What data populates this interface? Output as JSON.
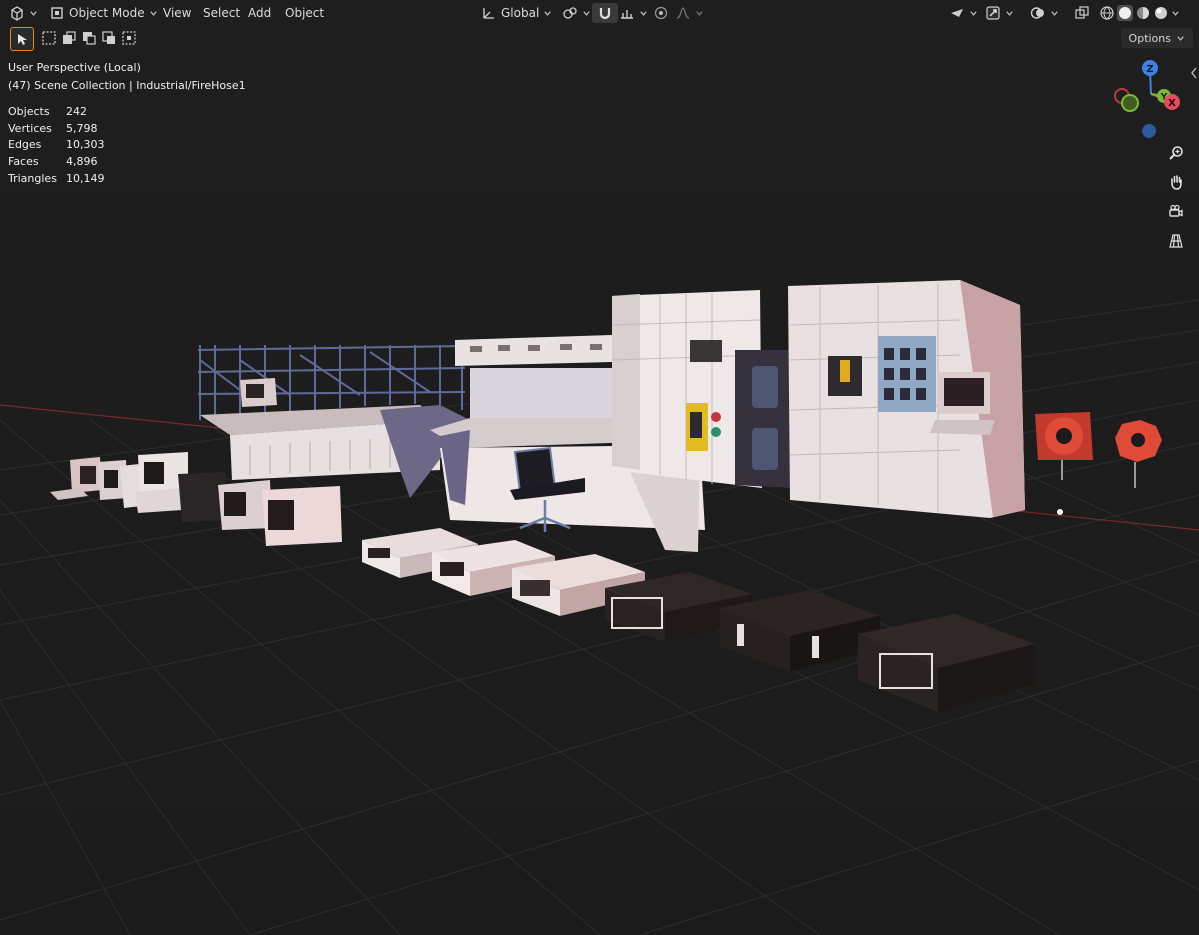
{
  "header": {
    "editor_type_icon": "view3d-icon",
    "mode_label": "Object Mode",
    "menu": [
      "View",
      "Select",
      "Add",
      "Object"
    ],
    "transform_orientation": "Global",
    "icons": {
      "pivot": "pivot-icon",
      "snap": "magnet-icon",
      "snap_target": "snap-increment-icon",
      "proportional": "proportional-edit-icon",
      "falloff": "falloff-curve-icon",
      "visibility": "visibility-icon",
      "gizmo": "gizmo-icon",
      "overlay": "overlay-icon",
      "xray": "xray-icon",
      "shading": [
        "wireframe-icon",
        "solid-icon",
        "material-preview-icon",
        "rendered-icon"
      ]
    }
  },
  "toolbar": {
    "options_label": "Options"
  },
  "viewport_info": {
    "perspective": "User Perspective (Local)",
    "collection": "(47) Scene Collection | Industrial/FireHose1"
  },
  "stats": [
    {
      "label": "Objects",
      "value": "242"
    },
    {
      "label": "Vertices",
      "value": "5,798"
    },
    {
      "label": "Edges",
      "value": "10,303"
    },
    {
      "label": "Faces",
      "value": "4,896"
    },
    {
      "label": "Triangles",
      "value": "10,149"
    }
  ],
  "gizmo": {
    "axes": [
      "Z",
      "Y",
      "X"
    ],
    "colors": {
      "x": "#e14b5a",
      "y": "#7cb83a",
      "z": "#3d82e0"
    }
  },
  "nav_buttons": [
    "zoom-icon",
    "pan-hand-icon",
    "camera-icon",
    "perspective-grid-icon"
  ],
  "colors": {
    "background": "#1d1d1d",
    "accent": "#e08a1e",
    "grid": "#2c2c2c",
    "x_axis": "#8a2a32"
  }
}
